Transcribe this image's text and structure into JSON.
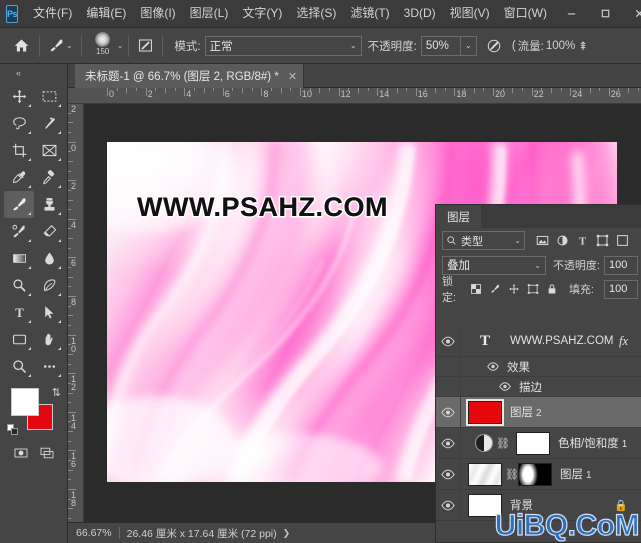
{
  "app": {
    "logo": "Ps",
    "menus": [
      {
        "label": "文件(F)"
      },
      {
        "label": "编辑(E)"
      },
      {
        "label": "图像(I)"
      },
      {
        "label": "图层(L)"
      },
      {
        "label": "文字(Y)"
      },
      {
        "label": "选择(S)"
      },
      {
        "label": "滤镜(T)"
      },
      {
        "label": "3D(D)"
      },
      {
        "label": "视图(V)"
      },
      {
        "label": "窗口(W)"
      }
    ],
    "window_controls": {
      "minimize": "—",
      "maximize": "❐",
      "close": "✕"
    }
  },
  "options_bar": {
    "home_icon": "home-icon",
    "tool_icon": "brush-icon",
    "brush_size": "150",
    "toggle_panel_icon": "brush-settings-icon",
    "mode_label": "模式:",
    "mode_value": "正常",
    "opacity_label": "不透明度:",
    "opacity_value": "50%",
    "airbrush_icon": "airbrush-icon",
    "flow_label": "流量:",
    "flow_value": "100%",
    "smoothing_icon": "smoothing-icon"
  },
  "document_tab": {
    "title": "未标题-1 @ 66.7% (图层 2, RGB/8#) *",
    "close": "✕"
  },
  "toolbar": {
    "collapse": "«",
    "tools": [
      {
        "name": "move-tool",
        "active": false
      },
      {
        "name": "marquee-tool",
        "active": false
      },
      {
        "name": "lasso-tool",
        "active": false
      },
      {
        "name": "magic-wand-tool",
        "active": false
      },
      {
        "name": "crop-tool",
        "active": false
      },
      {
        "name": "frame-tool",
        "active": false
      },
      {
        "name": "eyedropper-tool",
        "active": false
      },
      {
        "name": "healing-brush-tool",
        "active": false
      },
      {
        "name": "brush-tool",
        "active": true
      },
      {
        "name": "clone-stamp-tool",
        "active": false
      },
      {
        "name": "history-brush-tool",
        "active": false
      },
      {
        "name": "eraser-tool",
        "active": false
      },
      {
        "name": "gradient-tool",
        "active": false
      },
      {
        "name": "blur-tool",
        "active": false
      },
      {
        "name": "dodge-tool",
        "active": false
      },
      {
        "name": "pen-tool",
        "active": false
      },
      {
        "name": "type-tool",
        "active": false
      },
      {
        "name": "path-selection-tool",
        "active": false
      },
      {
        "name": "shape-tool",
        "active": false
      },
      {
        "name": "hand-tool",
        "active": false
      },
      {
        "name": "zoom-tool",
        "active": false
      },
      {
        "name": "more-tools",
        "active": false
      }
    ],
    "foreground_color": "#ffffff",
    "background_color": "#e30613",
    "swap_icon": "swap-colors-icon",
    "default_icon": "default-colors-icon",
    "quick_mask_icon": "quick-mask-icon",
    "screen_mode_icon": "screen-mode-icon"
  },
  "rulers": {
    "unit": "cm",
    "horizontal_labels": [
      "0",
      "2",
      "4",
      "6",
      "8",
      "10",
      "12",
      "14",
      "16",
      "18",
      "20",
      "22",
      "24",
      "26"
    ],
    "vertical_labels": [
      "2",
      "0",
      "2",
      "4",
      "6",
      "8",
      "10",
      "12",
      "14",
      "16",
      "18"
    ]
  },
  "canvas": {
    "watermark_text": "WWW.PSAHZ.COM",
    "background_color": "#2b2b2b"
  },
  "status_bar": {
    "zoom": "66.67%",
    "doc_size": "26.46 厘米 x 17.64 厘米 (72 ppi)",
    "expand": "❯"
  },
  "layers_panel": {
    "tab_label": "图层",
    "filter": {
      "icon": "search-icon",
      "value": "类型",
      "arrow": "⌄",
      "type_icons": [
        "image-filter-icon",
        "adjustment-filter-icon",
        "text-filter-icon",
        "shape-filter-icon",
        "smart-object-filter-icon"
      ]
    },
    "blend_mode": "叠加",
    "blend_arrow": "⌄",
    "opacity_label": "不透明度:",
    "opacity_value": "100",
    "lock_label": "锁定:",
    "lock_icons": [
      "lock-transparent-icon",
      "lock-image-icon",
      "lock-position-icon",
      "lock-artboard-icon",
      "lock-all-icon"
    ],
    "fill_label": "填充:",
    "fill_value": "100",
    "rows": [
      {
        "kind": "text",
        "name": "WWW.PSAHZ.COM",
        "suffix": "",
        "visible": true,
        "selected": false,
        "fx": "fx",
        "thumb": "type-T"
      },
      {
        "kind": "fx-group",
        "name": "效果",
        "visible": true,
        "indent": 1
      },
      {
        "kind": "fx-item",
        "name": "描边",
        "visible": true,
        "indent": 2
      },
      {
        "kind": "raster",
        "name": "图层",
        "suffix": "2",
        "visible": true,
        "selected": true,
        "thumb": "red"
      },
      {
        "kind": "adjustment",
        "name": "色相/饱和度",
        "suffix": "1",
        "visible": true,
        "selected": false,
        "thumb": "adjustment",
        "linked": true
      },
      {
        "kind": "raster-masked",
        "name": "图层",
        "suffix": "1",
        "visible": true,
        "selected": false,
        "thumb": "silkmini",
        "linked": true
      },
      {
        "kind": "background",
        "name": "背景",
        "suffix": "",
        "visible": true,
        "selected": false,
        "thumb": "white",
        "locked": "lock-icon"
      }
    ]
  },
  "corner_watermark": {
    "text": "UiBQ.CoM",
    "color": "#2f6fbe"
  }
}
